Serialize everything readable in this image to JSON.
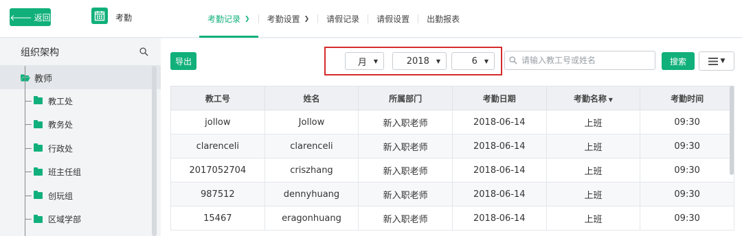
{
  "header": {
    "back_label": "返回",
    "app_title": "考勤",
    "nav": [
      {
        "label": "考勤记录",
        "active": true,
        "dropdown": true
      },
      {
        "label": "考勤设置",
        "active": false,
        "dropdown": true
      },
      {
        "label": "请假记录",
        "active": false,
        "dropdown": false
      },
      {
        "label": "请假设置",
        "active": false,
        "dropdown": false
      },
      {
        "label": "出勤报表",
        "active": false,
        "dropdown": false
      }
    ]
  },
  "sidebar": {
    "title": "组织架构",
    "root": "教师",
    "items": [
      "教工处",
      "教务处",
      "行政处",
      "班主任组",
      "创玩组",
      "区域学部"
    ]
  },
  "toolbar": {
    "export_label": "导出",
    "period_select": "月",
    "year_select": "2018",
    "month_select": "6",
    "search_placeholder": "请输入教工号或姓名",
    "search_label": "搜索"
  },
  "table": {
    "headers": [
      "教工号",
      "姓名",
      "所属部门",
      "考勤日期",
      "考勤名称",
      "考勤时间"
    ],
    "rows": [
      [
        "jollow",
        "Jollow",
        "新入职老师",
        "2018-06-14",
        "上班",
        "09:30"
      ],
      [
        "clarenceli",
        "clarenceli",
        "新入职老师",
        "2018-06-14",
        "上班",
        "09:30"
      ],
      [
        "2017052704",
        "criszhang",
        "新入职老师",
        "2018-06-14",
        "上班",
        "09:30"
      ],
      [
        "987512",
        "dennyhuang",
        "新入职老师",
        "2018-06-14",
        "上班",
        "09:30"
      ],
      [
        "15467",
        "eragonhuang",
        "新入职老师",
        "2018-06-14",
        "上班",
        "09:30"
      ]
    ]
  },
  "colors": {
    "accent": "#11b07a",
    "highlight": "#d62b2b"
  }
}
